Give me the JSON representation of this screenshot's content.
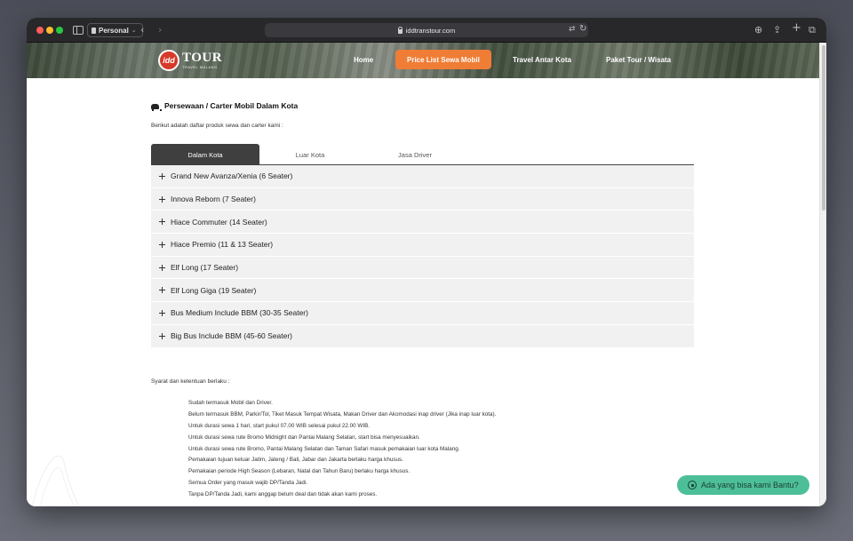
{
  "browser": {
    "profile_label": "Personal",
    "url": "iddtranstour.com"
  },
  "site": {
    "logo": {
      "badge": "idd",
      "main": "TOUR",
      "sub": "TRAVEL MALANG"
    },
    "menu": [
      {
        "label": "Home"
      },
      {
        "label": "Price List Sewa Mobil"
      },
      {
        "label": "Travel Antar Kota"
      },
      {
        "label": "Paket Tour / Wisata"
      }
    ]
  },
  "page": {
    "section_title": "Persewaan / Carter Mobil Dalam Kota",
    "intro": "Berikut adalah daftar produk sewa dan carter kami :",
    "tabs": [
      {
        "label": "Dalam Kota"
      },
      {
        "label": "Luar Kota"
      },
      {
        "label": "Jasa Driver"
      }
    ],
    "vehicles": [
      "Grand New Avanza/Xenia (6 Seater)",
      "Innova Reborn (7 Seater)",
      "Hiace Commuter (14 Seater)",
      "Hiace Premio (11 & 13 Seater)",
      "Elf Long (17 Seater)",
      "Elf Long Giga (19 Seater)",
      "Bus Medium Include BBM (30-35 Seater)",
      "Big Bus Include BBM (45-60 Seater)"
    ],
    "terms_label": "Syarat dan ketentuan berlaku :",
    "terms": [
      "Sudah termasuk Mobil dan Driver.",
      "Belum termasuk BBM, Parkir/Tol, Tiket Masuk Tempat Wisata, Makan Driver dan Akomodasi inap driver (Jika inap luar kota).",
      "Untuk durasi sewa 1 hari, start pukul 07.00 WIB selesai pukul 22.00 WIB.",
      "Untuk durasi sewa rute Bromo Midnight dan Pantai Malang Selatan, start bisa menyesuaikan.",
      "Untuk durasi sewa rute Bromo,  Pantai Malang Selatan dan Taman Safari masuk pemakaian luar kota Malang.",
      "Pemakaian tujuan keluar Jatim, Jateng / Bali, Jabar dan Jakarta berlaku harga khusus.",
      "Pemakaian periode High Season (Lebaran, Natal dan Tahun Baru) berlaku harga khusus.",
      "Semua Order yang masuk wajib DP/Tanda Jadi.",
      "Tanpa DP/Tanda Jadi, kami anggap belum deal dan tidak akan kami proses."
    ],
    "chat_button": "Ada yang bisa kami Bantu?"
  },
  "colors": {
    "accent_orange": "#f07d35",
    "tab_active": "#3f3f3f",
    "chat_green": "#4dbf98"
  }
}
